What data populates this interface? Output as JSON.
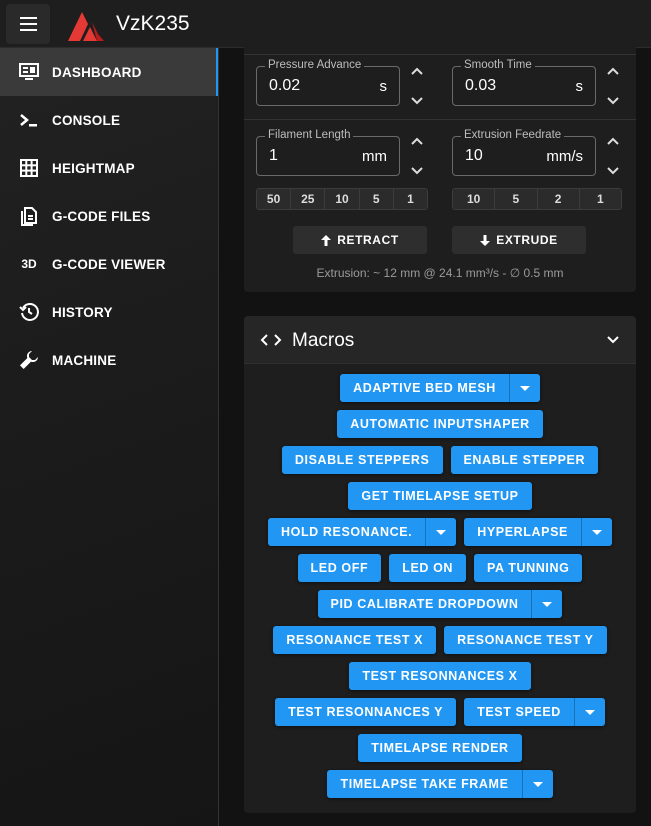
{
  "app": {
    "title": "VzK235"
  },
  "sidebar": {
    "items": [
      {
        "label": "DASHBOARD",
        "icon": "monitor-dashboard-icon",
        "active": true
      },
      {
        "label": "CONSOLE",
        "icon": "console-icon"
      },
      {
        "label": "HEIGHTMAP",
        "icon": "grid-icon"
      },
      {
        "label": "G-CODE FILES",
        "icon": "file-document-icon"
      },
      {
        "label": "G-CODE VIEWER",
        "icon": "3d-icon",
        "glyph": "3D"
      },
      {
        "label": "HISTORY",
        "icon": "history-icon"
      },
      {
        "label": "MACHINE",
        "icon": "wrench-icon"
      }
    ]
  },
  "extruder": {
    "pressure_advance": {
      "label": "Pressure Advance",
      "value": "0.02",
      "unit": "s"
    },
    "smooth_time": {
      "label": "Smooth Time",
      "value": "0.03",
      "unit": "s"
    },
    "filament_length": {
      "label": "Filament Length",
      "value": "1",
      "unit": "mm"
    },
    "extrusion_feedrate": {
      "label": "Extrusion Feedrate",
      "value": "10",
      "unit": "mm/s"
    },
    "length_presets": [
      "50",
      "25",
      "10",
      "5",
      "1"
    ],
    "feedrate_presets": [
      "10",
      "5",
      "2",
      "1"
    ],
    "retract_label": "RETRACT",
    "extrude_label": "EXTRUDE",
    "info": "Extrusion: ~ 12 mm @ 24.1 mm³/s - ∅ 0.5 mm"
  },
  "macros": {
    "title": "Macros",
    "rows": [
      [
        {
          "label": "ADAPTIVE BED MESH",
          "dropdown": true
        }
      ],
      [
        {
          "label": "AUTOMATIC INPUTSHAPER"
        }
      ],
      [
        {
          "label": "DISABLE STEPPERS"
        },
        {
          "label": "ENABLE STEPPER"
        }
      ],
      [
        {
          "label": "GET TIMELAPSE SETUP"
        }
      ],
      [
        {
          "label": "HOLD RESONANCE.",
          "dropdown": true
        },
        {
          "label": "HYPERLAPSE",
          "dropdown": true
        }
      ],
      [
        {
          "label": "LED OFF"
        },
        {
          "label": "LED ON"
        },
        {
          "label": "PA TUNNING"
        }
      ],
      [
        {
          "label": "PID CALIBRATE DROPDOWN",
          "dropdown": true
        }
      ],
      [
        {
          "label": "RESONANCE TEST X"
        },
        {
          "label": "RESONANCE TEST Y"
        }
      ],
      [
        {
          "label": "TEST RESONNANCES X"
        }
      ],
      [
        {
          "label": "TEST RESONNANCES Y"
        },
        {
          "label": "TEST SPEED",
          "dropdown": true
        }
      ],
      [
        {
          "label": "TIMELAPSE RENDER"
        }
      ],
      [
        {
          "label": "TIMELAPSE TAKE FRAME",
          "dropdown": true
        }
      ]
    ]
  },
  "colors": {
    "accent": "#2196f3",
    "logo_red": "#e53935"
  }
}
